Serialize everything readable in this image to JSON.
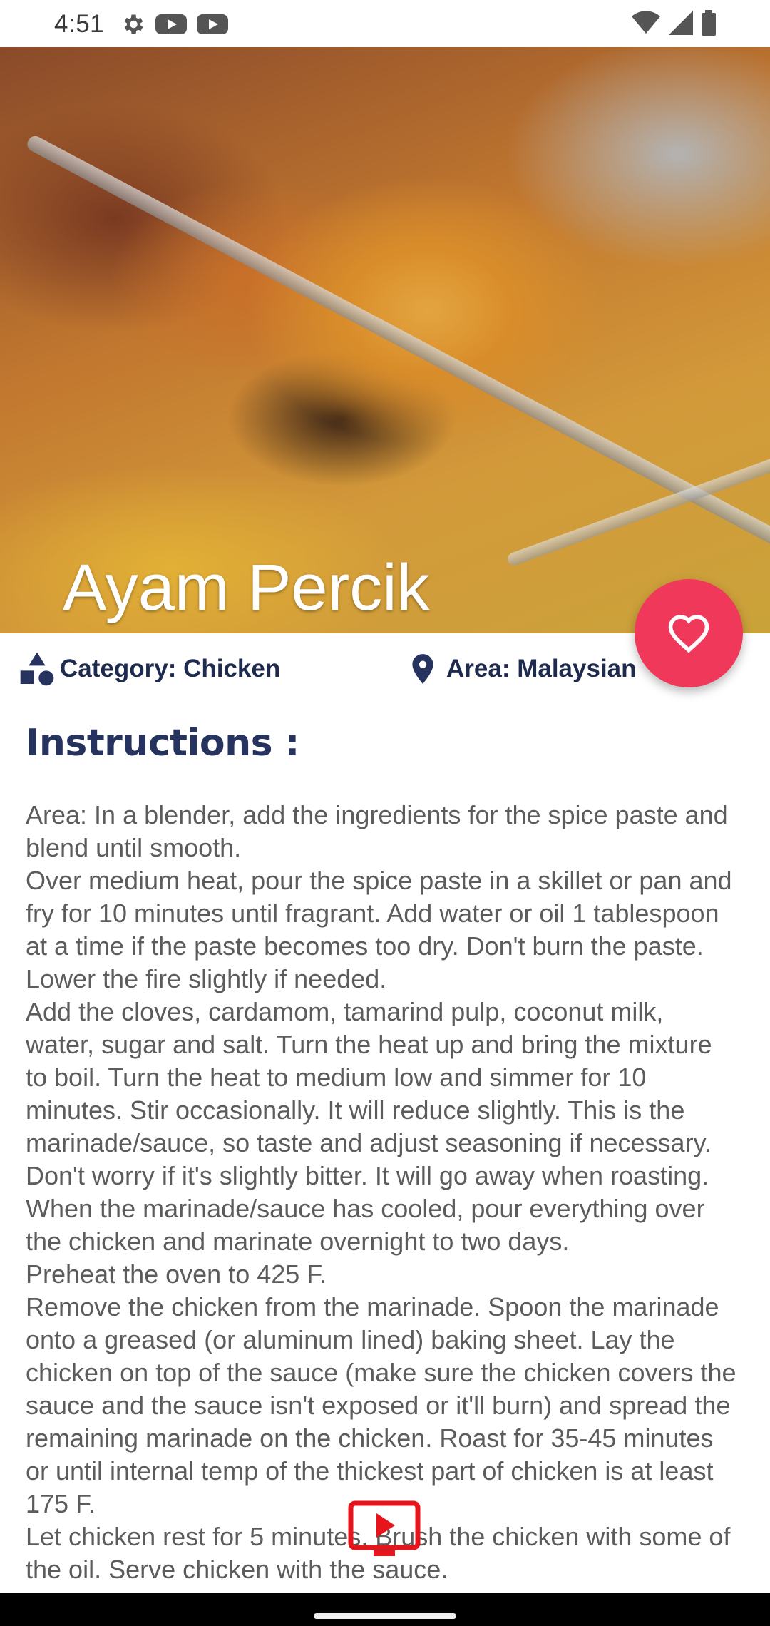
{
  "status_bar": {
    "time": "4:51",
    "left_icons": [
      "gear-icon",
      "youtube-icon",
      "youtube-icon"
    ],
    "right_icons": [
      "wifi-icon",
      "signal-icon",
      "battery-icon"
    ]
  },
  "recipe": {
    "title": "Ayam Percik",
    "category_label": "Category: Chicken",
    "area_label": "Area: Malaysian",
    "instructions_heading": "Instructions :",
    "instructions_text": "Area: In a blender, add the ingredients for the spice paste and blend until smooth.\nOver medium heat, pour the spice paste in a skillet or pan and fry for 10 minutes until fragrant. Add water or oil 1 tablespoon at a time if the paste becomes too dry. Don't burn the paste. Lower the fire slightly if needed.\nAdd the cloves, cardamom, tamarind pulp, coconut milk, water, sugar and salt. Turn the heat up and bring the mixture to boil. Turn the heat to medium low and simmer for 10 minutes. Stir occasionally. It will reduce slightly. This is the marinade/sauce, so taste and adjust seasoning if necessary. Don't worry if it's slightly bitter. It will go away when roasting.\nWhen the marinade/sauce has cooled, pour everything over the chicken and marinate overnight to two days.\nPreheat the oven to 425 F.\nRemove the chicken from the marinade. Spoon the marinade onto a greased (or aluminum lined) baking sheet. Lay the chicken on top of the sauce (make sure the chicken covers the sauce and the sauce isn't exposed or it'll burn) and spread the remaining marinade on the chicken. Roast for 35-45 minutes or until internal temp of the thickest part of chicken is at least 175 F.\nLet chicken rest for 5 minutes. Brush the chicken with some of the oil. Serve chicken with the sauce."
  },
  "icons": {
    "favorite": "heart-outline-icon",
    "category": "category-shapes-icon",
    "area": "location-pin-icon",
    "video": "play-video-icon"
  },
  "colors": {
    "accent": "#f0395a",
    "heading": "#25335e",
    "body_text": "#5c5c5c",
    "video_red": "#e8141c"
  }
}
